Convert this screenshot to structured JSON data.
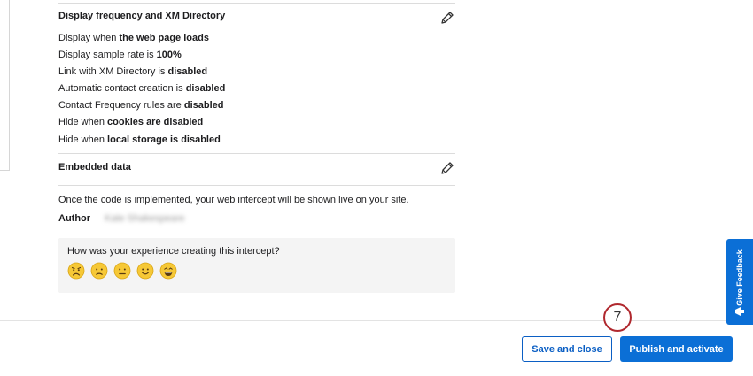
{
  "frequency_section": {
    "title": "Display frequency and XM Directory",
    "lines": [
      {
        "pre": "Display when ",
        "bold": "the web page loads",
        "post": ""
      },
      {
        "pre": "Display sample rate is ",
        "bold": "100%",
        "post": ""
      },
      {
        "pre": "Link with XM Directory is ",
        "bold": "disabled",
        "post": ""
      },
      {
        "pre": "Automatic contact creation is ",
        "bold": "disabled",
        "post": ""
      },
      {
        "pre": "Contact Frequency rules are ",
        "bold": "disabled",
        "post": ""
      },
      {
        "pre": "Hide when ",
        "bold": "cookies are disabled",
        "post": ""
      },
      {
        "pre": "Hide when ",
        "bold": "local storage is disabled",
        "post": ""
      }
    ]
  },
  "embedded_section": {
    "title": "Embedded data"
  },
  "implemented_note": "Once the code is implemented, your web intercept will be shown live on your site.",
  "author": {
    "label": "Author",
    "name": "Kate Shakespeare"
  },
  "survey": {
    "question": "How was your experience creating this intercept?",
    "faces": [
      "very-unhappy",
      "unhappy",
      "neutral",
      "happy",
      "very-happy"
    ]
  },
  "footer": {
    "save_label": "Save and close",
    "publish_label": "Publish and activate"
  },
  "step_badge": "7",
  "feedback_tab": {
    "label": "Give Feedback"
  },
  "colors": {
    "primary": "#0b6fd6",
    "badge_ring": "#b0282e",
    "emoji_yellow": "#f6c836"
  }
}
